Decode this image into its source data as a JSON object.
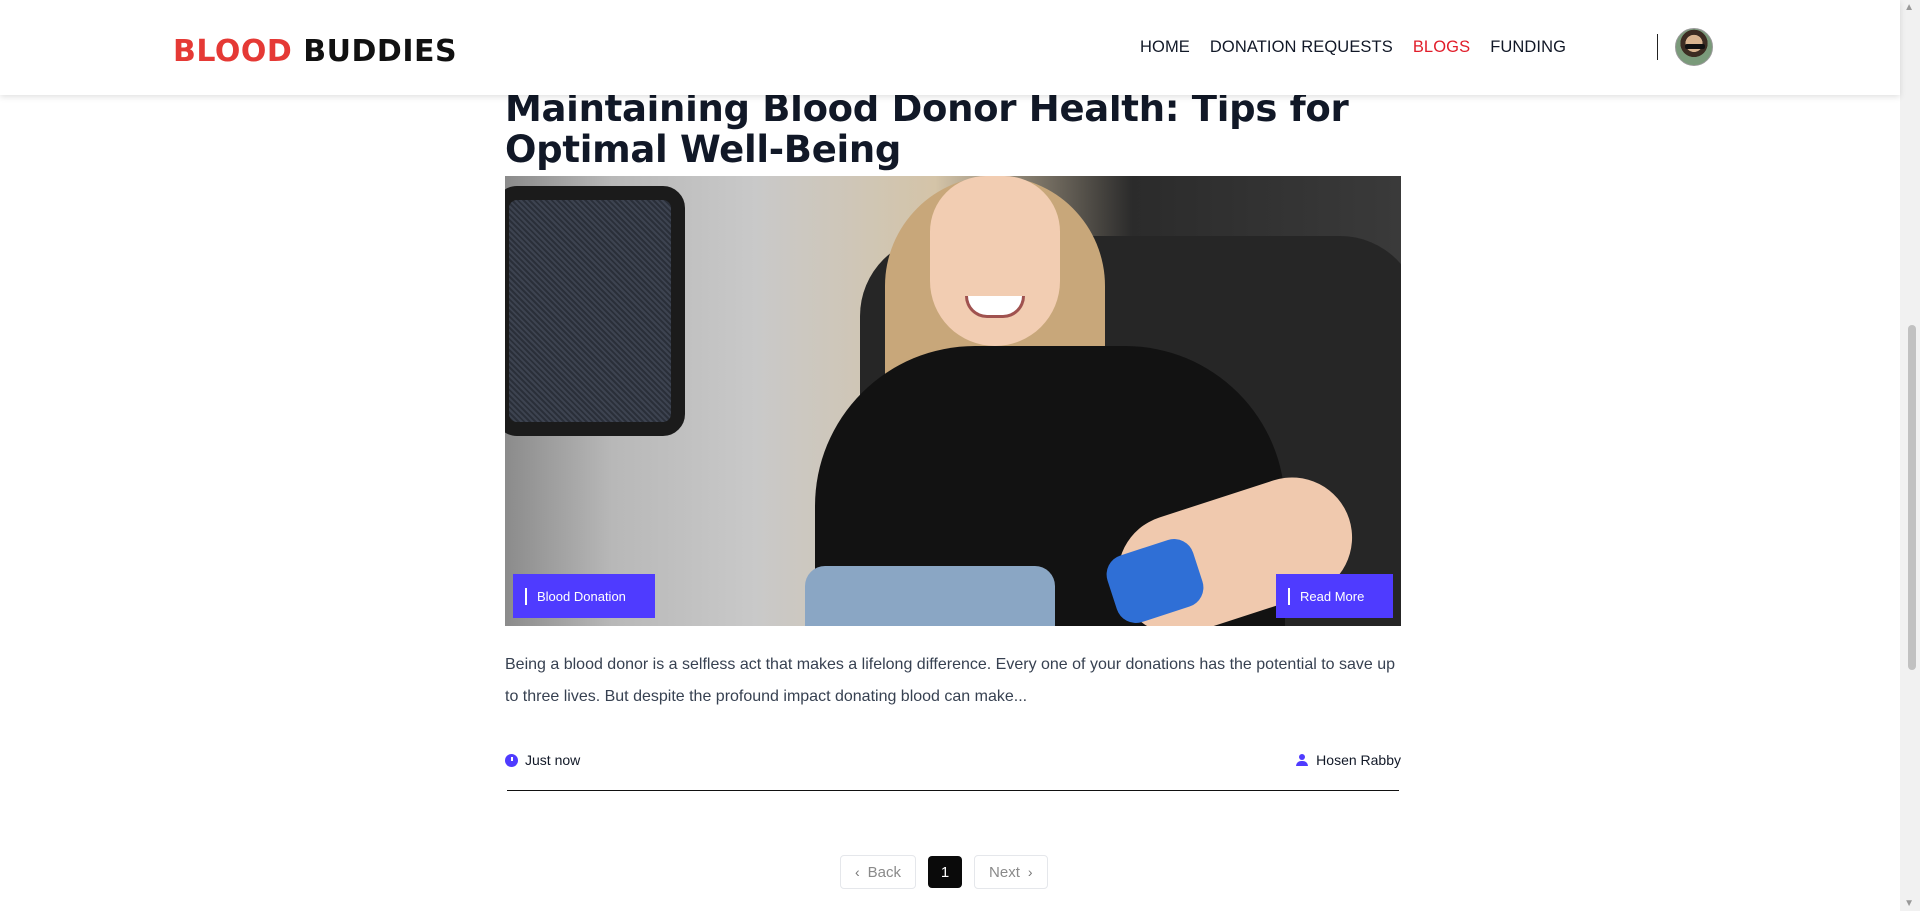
{
  "brand": {
    "part1": "BLOOD",
    "part2": "BUDDIES",
    "accent_color": "#e53935"
  },
  "nav": [
    {
      "label": "HOME",
      "active": false
    },
    {
      "label": "DONATION REQUESTS",
      "active": false
    },
    {
      "label": "BLOGS",
      "active": true
    },
    {
      "label": "FUNDING",
      "active": false
    }
  ],
  "blog": {
    "title": "Maintaining Blood Donor Health: Tips for Optimal Well-Being",
    "category": "Blood Donation",
    "read_more": "Read More",
    "excerpt": "Being a blood donor is a selfless act that makes a lifelong difference. Every one of your donations has the potential to save up to three lives. But despite the profound impact donating blood can make...",
    "time": "Just now",
    "author": "Hosen Rabby",
    "button_color": "#4f3bff"
  },
  "pagination": {
    "back": "Back",
    "current": "1",
    "next": "Next"
  }
}
